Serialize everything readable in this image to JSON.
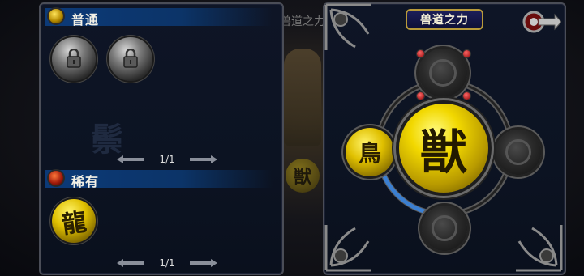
{
  "background": {
    "title": "兽道之力",
    "emblem_char": "獣"
  },
  "left_panel": {
    "common": {
      "label": "普通",
      "slots": [
        {
          "state": "locked",
          "icon": "padlock-icon"
        },
        {
          "state": "locked",
          "icon": "padlock-icon"
        }
      ],
      "pager": {
        "text": "1/1"
      }
    },
    "rare": {
      "label": "稀有",
      "slots": [
        {
          "state": "owned",
          "icon": "golden-beast-orb",
          "glyph": "龍"
        }
      ],
      "pager": {
        "text": "1/1"
      }
    }
  },
  "right_panel": {
    "title": "兽道之力",
    "center_orb": {
      "glyph": "獣",
      "icon": "beast-power-core"
    },
    "left_orb": {
      "glyph": "鳥",
      "icon": "golden-bird-orb"
    },
    "empty_slots": [
      "top",
      "right",
      "bottom"
    ],
    "back_button": {
      "icon": "back-arrow-icon"
    }
  },
  "colors": {
    "panel_bg": "#0e1526",
    "section_header": "#0c3a78",
    "gold": "#e0c000",
    "title_border": "#b89a3a"
  }
}
